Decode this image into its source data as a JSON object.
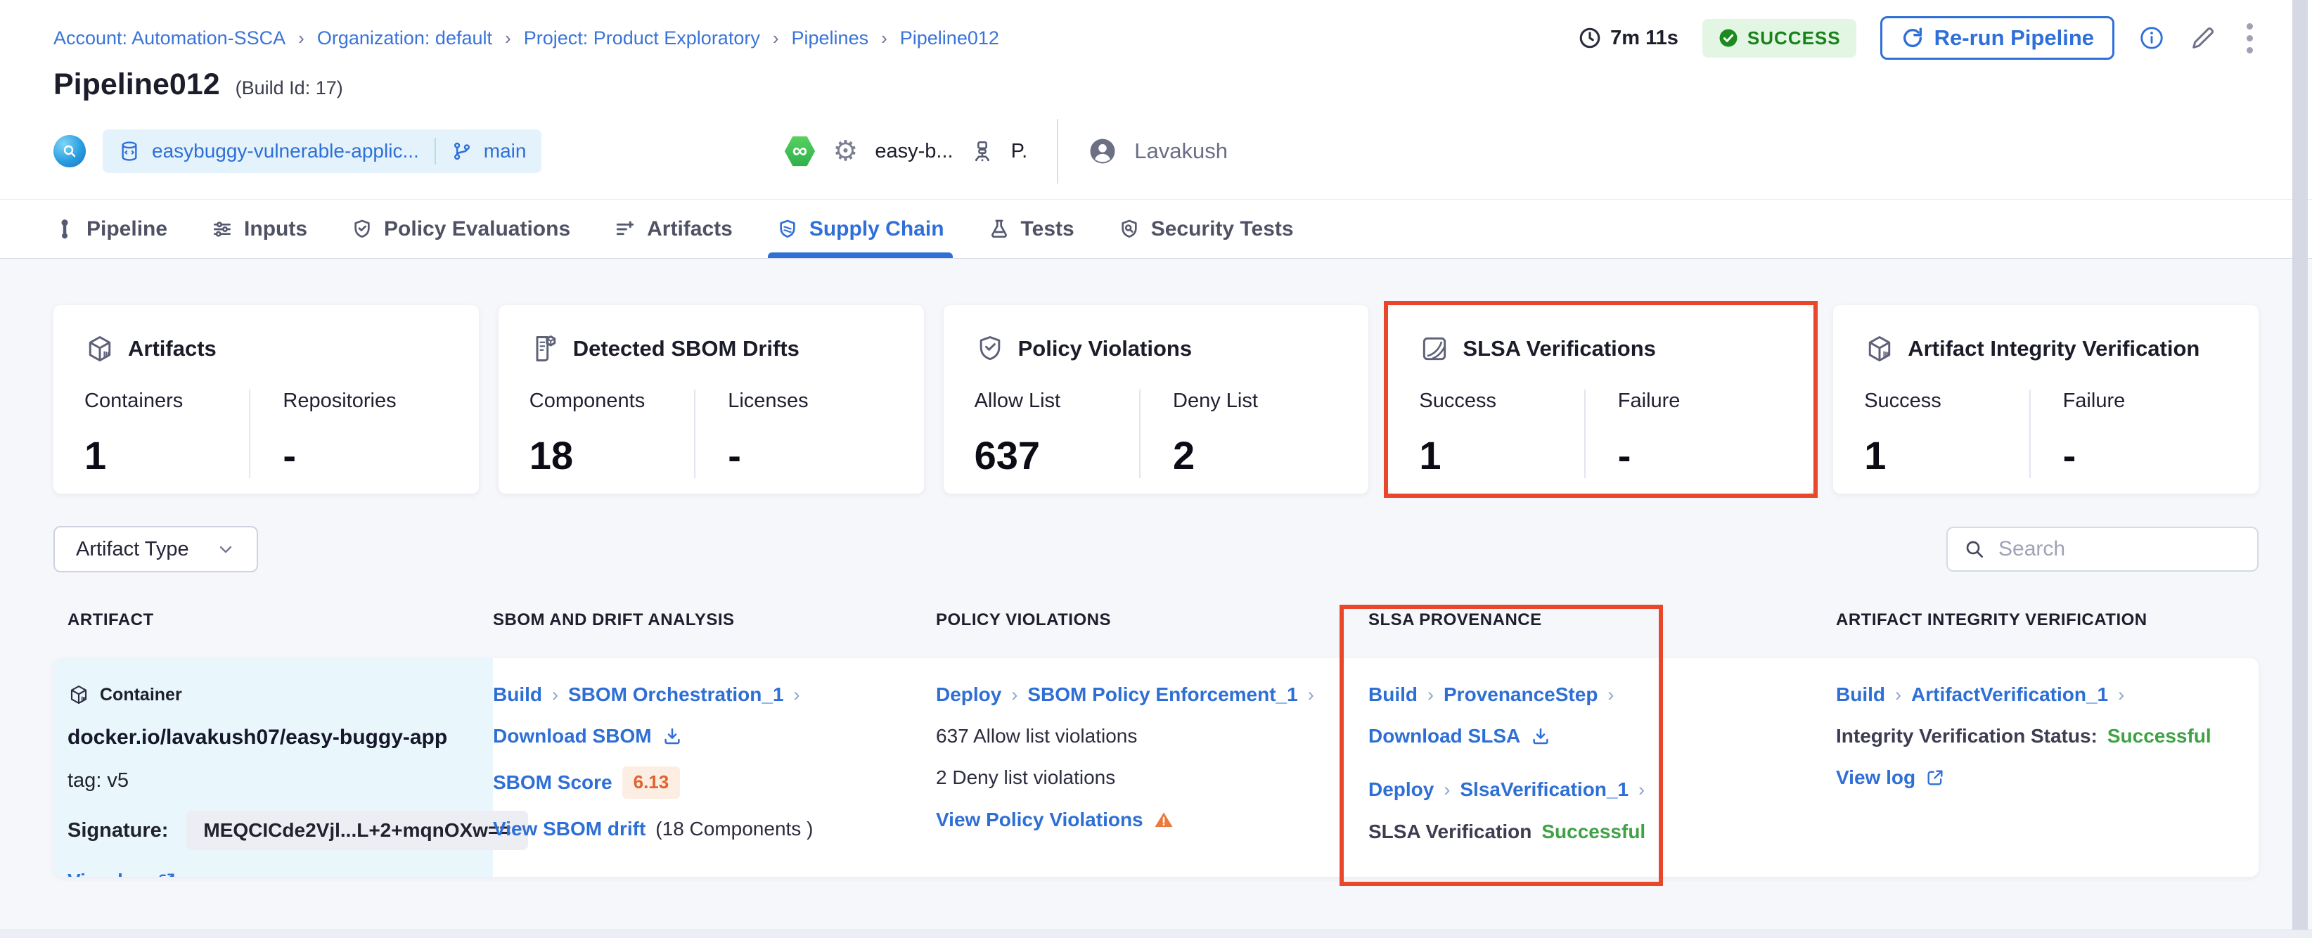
{
  "breadcrumb": {
    "items": [
      "Account: Automation-SSCA",
      "Organization: default",
      "Project: Product Exploratory",
      "Pipelines",
      "Pipeline012"
    ]
  },
  "header": {
    "title": "Pipeline012",
    "build_id": "(Build Id: 17)",
    "duration": "7m 11s",
    "status": "SUCCESS",
    "rerun_label": "Re-run Pipeline",
    "repo": "easybuggy-vulnerable-applic...",
    "branch": "main",
    "trigger_label": "easy-b...",
    "delegate_label": "P.",
    "user": "Lavakush"
  },
  "tabs": [
    {
      "label": "Pipeline",
      "active": false
    },
    {
      "label": "Inputs",
      "active": false
    },
    {
      "label": "Policy Evaluations",
      "active": false
    },
    {
      "label": "Artifacts",
      "active": false
    },
    {
      "label": "Supply Chain",
      "active": true
    },
    {
      "label": "Tests",
      "active": false
    },
    {
      "label": "Security Tests",
      "active": false
    }
  ],
  "summary_cards": [
    {
      "title": "Artifacts",
      "stats": [
        {
          "label": "Containers",
          "value": "1"
        },
        {
          "label": "Repositories",
          "value": "-"
        }
      ]
    },
    {
      "title": "Detected SBOM Drifts",
      "stats": [
        {
          "label": "Components",
          "value": "18"
        },
        {
          "label": "Licenses",
          "value": "-"
        }
      ]
    },
    {
      "title": "Policy Violations",
      "stats": [
        {
          "label": "Allow List",
          "value": "637"
        },
        {
          "label": "Deny List",
          "value": "2"
        }
      ]
    },
    {
      "title": "SLSA Verifications",
      "highlighted": true,
      "stats": [
        {
          "label": "Success",
          "value": "1"
        },
        {
          "label": "Failure",
          "value": "-"
        }
      ]
    },
    {
      "title": "Artifact Integrity Verification",
      "stats": [
        {
          "label": "Success",
          "value": "1"
        },
        {
          "label": "Failure",
          "value": "-"
        }
      ]
    }
  ],
  "filters": {
    "artifact_type_label": "Artifact Type",
    "search_placeholder": "Search"
  },
  "table": {
    "columns": [
      "ARTIFACT",
      "SBOM AND DRIFT ANALYSIS",
      "POLICY VIOLATIONS",
      "SLSA PROVENANCE",
      "ARTIFACT INTEGRITY VERIFICATION"
    ],
    "row": {
      "artifact": {
        "type_label": "Container",
        "name": "docker.io/lavakush07/easy-buggy-app",
        "tag": "tag: v5",
        "signature_label": "Signature:",
        "signature_value": "MEQCICde2Vjl...L+2+mqnOXw==",
        "view_log": "View log"
      },
      "sbom": {
        "stage": "Build",
        "step": "SBOM Orchestration_1",
        "download_label": "Download SBOM",
        "score_label": "SBOM Score",
        "score_value": "6.13",
        "drift_link": "View SBOM drift",
        "drift_suffix": "(18 Components )"
      },
      "policy": {
        "stage": "Deploy",
        "step": "SBOM Policy Enforcement_1",
        "allow_text": "637 Allow list violations",
        "deny_text": "2 Deny list violations",
        "view_link": "View Policy Violations"
      },
      "slsa": {
        "stage1": "Build",
        "step1": "ProvenanceStep",
        "download_label": "Download SLSA",
        "stage2": "Deploy",
        "step2": "SlsaVerification_1",
        "status_label": "SLSA Verification",
        "status_value": "Successful"
      },
      "integrity": {
        "stage": "Build",
        "step": "ArtifactVerification_1",
        "status_label": "Integrity Verification Status:",
        "status_value": "Successful",
        "view_log": "View log"
      }
    }
  },
  "colors": {
    "link_blue": "#2e6fd6",
    "success_green": "#3fa246",
    "badge_green_bg": "#e3f6e4",
    "badge_green_text": "#17821a",
    "highlight_red": "#e8472c",
    "score_orange": "#e2622f",
    "artifact_cell_bg": "#e9f7fd"
  }
}
